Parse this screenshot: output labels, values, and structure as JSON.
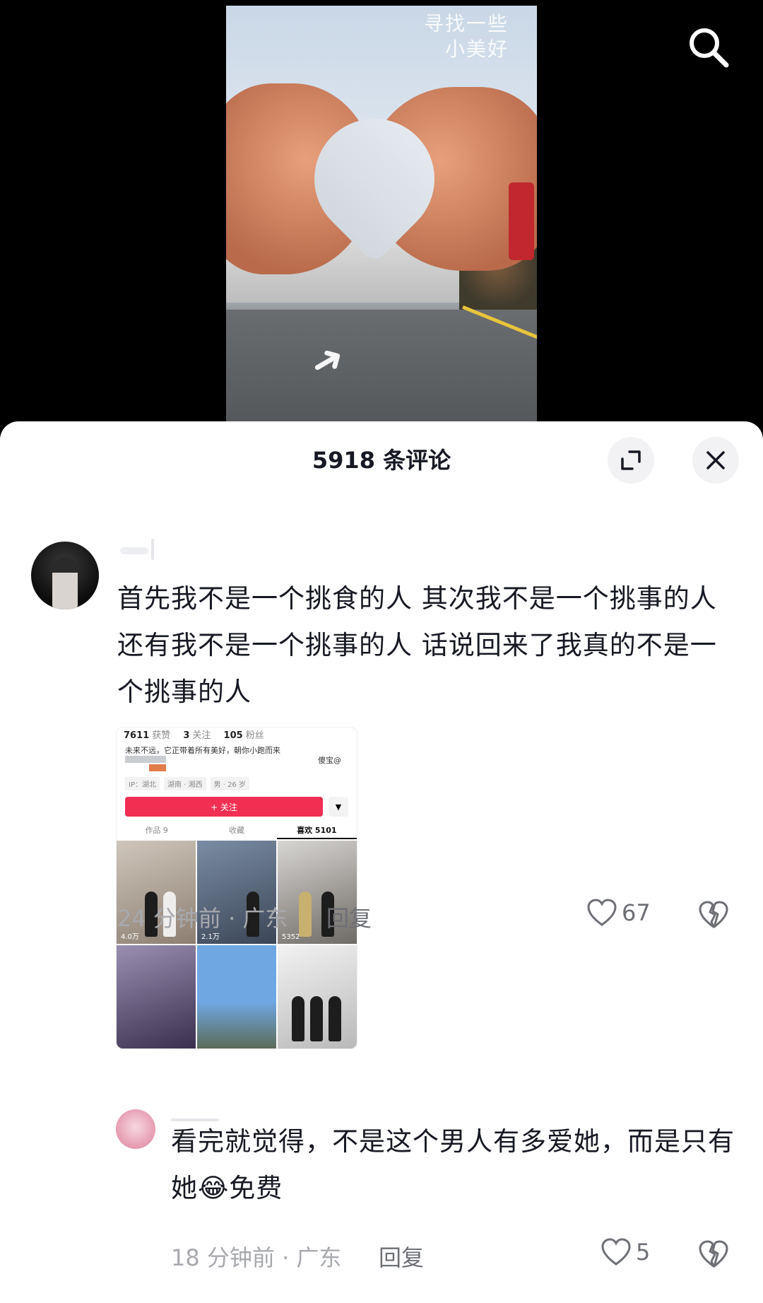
{
  "video": {
    "watermark_line1": "寻找一些",
    "watermark_line2": "小美好"
  },
  "comments_panel": {
    "title": "5918 条评论"
  },
  "comments": [
    {
      "text": "首先我不是一个挑食的人   其次我不是一个挑事的人    还有我不是一个挑事的人   话说回来了我真的不是一个挑事的人",
      "meta": "24 分钟前 · 广东",
      "reply_label": "回复",
      "like_count": "67"
    },
    {
      "text_before_emoji": "看完就觉得，不是这个男人有多爱她，而是只有她",
      "emoji": "😂",
      "text_after_emoji": "免费",
      "meta": "18 分钟前 · 广东",
      "reply_label": "回复",
      "like_count": "5"
    }
  ],
  "embedded_screenshot": {
    "likes_num": "7611",
    "likes_label": "获赞",
    "following_num": "3",
    "following_label": "关注",
    "followers_num": "105",
    "followers_label": "粉丝",
    "bio": "未来不远，它正带着所有美好，朝你小跑而来",
    "handle": "傻宝@",
    "tags": [
      "IP：湖北",
      "湖南 · 湘西",
      "男 · 26 岁"
    ],
    "follow_button": "+ 关注",
    "more_icon": "▼",
    "tabs": [
      "作品 9",
      "收藏",
      "喜欢 5101"
    ],
    "grid_counts": [
      "4.0万",
      "2.1万",
      "5352",
      "",
      "",
      ""
    ]
  }
}
